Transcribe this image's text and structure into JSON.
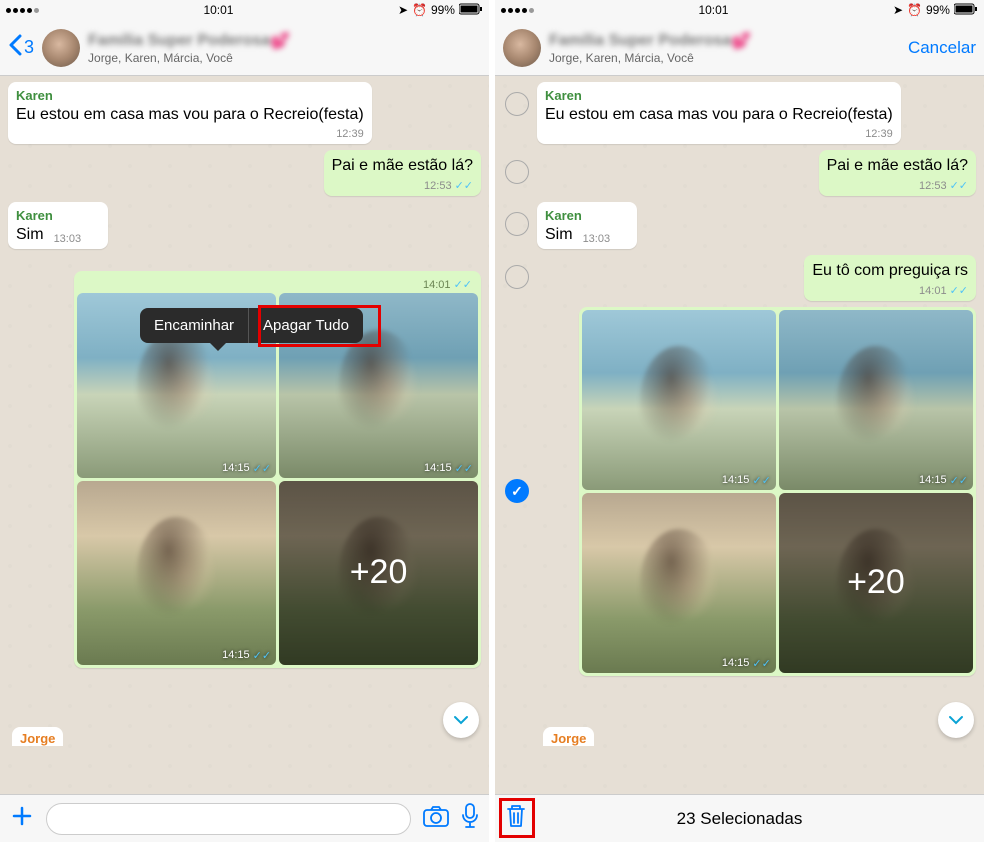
{
  "status": {
    "time": "10:01",
    "battery": "99%",
    "indicator_icons": [
      "location",
      "alarm"
    ]
  },
  "chat": {
    "back_count": "3",
    "group_name_blurred": "Família Super Poderosa",
    "group_emoji": "💕",
    "participants": "Jorge, Karen, Márcia, Você",
    "cancel_label": "Cancelar"
  },
  "messages": {
    "m1": {
      "sender": "Karen",
      "sender_color": "#3f8f3f",
      "text": "Eu estou em casa mas vou para o Recreio(festa)",
      "time": "12:39"
    },
    "m2": {
      "text": "Pai e mãe estão lá?",
      "time": "12:53"
    },
    "m3": {
      "sender": "Karen",
      "sender_color": "#3f8f3f",
      "text": "Sim",
      "time": "13:03"
    },
    "m4": {
      "text": "Eu tô com preguiça rs",
      "time": "14:01"
    }
  },
  "photos": {
    "ts1": "14:15",
    "ts2": "14:15",
    "ts3": "14:15",
    "more_overlay": "+20"
  },
  "popover": {
    "forward": "Encaminhar",
    "delete_all": "Apagar Tudo"
  },
  "partial_sender": "Jorge",
  "selection_bar": {
    "count_label": "23 Selecionadas"
  },
  "ticks": "✓✓"
}
